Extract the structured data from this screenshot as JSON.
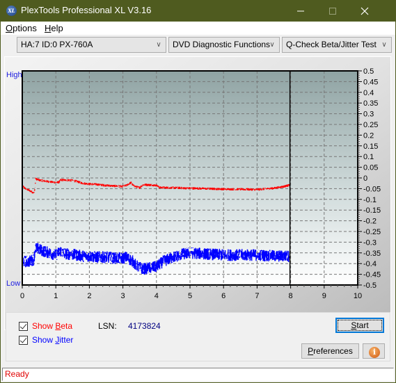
{
  "window": {
    "title": "PlexTools Professional XL V3.16",
    "app_icon_text": "XL",
    "controls": {
      "minimize": "—",
      "maximize": "☐",
      "close": "✕"
    }
  },
  "menu": {
    "items": [
      {
        "label": "Options",
        "accel": "O",
        "rest": "ptions"
      },
      {
        "label": "Help",
        "accel": "H",
        "rest": "elp"
      }
    ]
  },
  "toolbar": {
    "drive_select": "HA:7 ID:0  PX-760A",
    "function_select": "DVD Diagnostic Functions",
    "test_select": "Q-Check Beta/Jitter Test",
    "arrow": "∨"
  },
  "chart_data": {
    "type": "line",
    "title": "",
    "left_axis_labels": {
      "high": "High",
      "low": "Low"
    },
    "xlabel": "",
    "ylabel": "",
    "xlim": [
      0,
      10
    ],
    "ylim": [
      -0.5,
      0.5
    ],
    "x_ticks": [
      0,
      1,
      2,
      3,
      4,
      5,
      6,
      7,
      8,
      9,
      10
    ],
    "y_ticks": [
      0.5,
      0.45,
      0.4,
      0.35,
      0.3,
      0.25,
      0.2,
      0.15,
      0.1,
      0.05,
      0,
      -0.05,
      -0.1,
      -0.15,
      -0.2,
      -0.25,
      -0.3,
      -0.35,
      -0.4,
      -0.45,
      -0.5
    ],
    "y_tick_labels": [
      "0.5",
      "0.45",
      "0.4",
      "0.35",
      "0.3",
      "0.25",
      "0.2",
      "0.15",
      "0.1",
      "0.05",
      "0",
      "-0.05",
      "-0.1",
      "-0.15",
      "-0.2",
      "-0.25",
      "-0.3",
      "-0.35",
      "-0.4",
      "-0.45",
      "-0.5"
    ],
    "grid": true,
    "marker_x": 7.98,
    "series": [
      {
        "name": "Beta",
        "color": "#ff0000",
        "x": [
          0.0,
          0.1,
          0.2,
          0.3,
          0.35,
          0.38,
          0.4,
          0.5,
          0.7,
          0.9,
          1.1,
          1.15,
          1.2,
          1.4,
          1.6,
          1.8,
          2.0,
          2.2,
          2.5,
          2.8,
          3.0,
          3.1,
          3.2,
          3.25,
          3.3,
          3.4,
          3.5,
          3.6,
          3.7,
          3.9,
          4.0,
          4.1,
          4.5,
          5.0,
          5.5,
          6.0,
          6.5,
          7.0,
          7.5,
          7.8,
          7.98
        ],
        "y": [
          -0.037,
          -0.05,
          -0.058,
          -0.066,
          -0.07,
          -0.045,
          -0.004,
          -0.01,
          -0.015,
          -0.02,
          -0.02,
          -0.008,
          -0.01,
          -0.01,
          -0.015,
          -0.025,
          -0.028,
          -0.03,
          -0.035,
          -0.038,
          -0.04,
          -0.035,
          -0.025,
          -0.022,
          -0.035,
          -0.042,
          -0.045,
          -0.032,
          -0.032,
          -0.033,
          -0.035,
          -0.045,
          -0.046,
          -0.048,
          -0.05,
          -0.052,
          -0.053,
          -0.054,
          -0.048,
          -0.04,
          -0.033
        ],
        "noise": 0.006
      },
      {
        "name": "Jitter",
        "color": "#0000ff",
        "x": [
          0.0,
          0.2,
          0.35,
          0.38,
          0.45,
          0.6,
          0.8,
          1.0,
          1.15,
          1.2,
          1.35,
          1.6,
          1.8,
          2.0,
          2.2,
          2.5,
          2.8,
          3.0,
          3.1,
          3.3,
          3.4,
          3.6,
          3.8,
          4.0,
          4.2,
          4.5,
          4.8,
          5.0,
          5.5,
          6.0,
          6.5,
          7.0,
          7.5,
          7.98
        ],
        "y": [
          -0.39,
          -0.39,
          -0.38,
          -0.33,
          -0.33,
          -0.34,
          -0.35,
          -0.36,
          -0.34,
          -0.35,
          -0.355,
          -0.36,
          -0.365,
          -0.365,
          -0.37,
          -0.37,
          -0.375,
          -0.375,
          -0.37,
          -0.39,
          -0.41,
          -0.425,
          -0.42,
          -0.415,
          -0.39,
          -0.37,
          -0.355,
          -0.35,
          -0.355,
          -0.36,
          -0.36,
          -0.36,
          -0.365,
          -0.365
        ],
        "noise": 0.028
      }
    ]
  },
  "controls": {
    "show_beta": {
      "label_prefix": "Show ",
      "accel": "B",
      "rest": "eta",
      "checked": true,
      "color": "#ff0000"
    },
    "show_jitter": {
      "label_prefix": "Show ",
      "accel": "J",
      "rest": "itter",
      "checked": true,
      "color": "#0000ff"
    },
    "lsn_label": "LSN:",
    "lsn_value": "4173824",
    "start_button": {
      "accel": "S",
      "rest": "tart"
    },
    "preferences_button": {
      "accel": "P",
      "rest": "references"
    },
    "info_button_glyph": "i"
  },
  "status": {
    "text": "Ready"
  }
}
